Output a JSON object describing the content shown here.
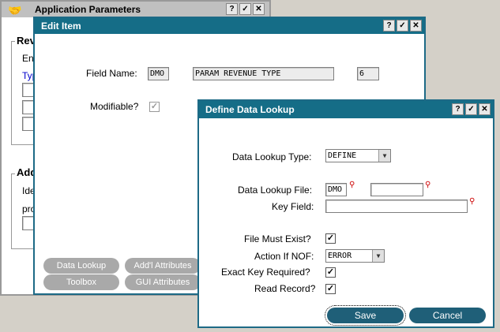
{
  "app_window": {
    "title": "Application Parameters",
    "title_buttons": [
      "?",
      "✓",
      "✕"
    ],
    "group1_title": "Rev",
    "group1_text1": "En",
    "group1_link": "Typ",
    "group2_title": "Add",
    "group2_text1": "Ide",
    "group2_text2": "pro"
  },
  "edit_item": {
    "title": "Edit Item",
    "title_buttons": [
      "?",
      "✓",
      "✕"
    ],
    "field_name_label": "Field Name:",
    "field_prefix": "DMO",
    "field_name": "PARAM REVENUE TYPE",
    "field_number": "6",
    "modifiable_label": "Modifiable?",
    "modifiable_check": "✓",
    "buttons": {
      "data_lookup": "Data Lookup",
      "addl_attributes": "Add'l Attributes",
      "toolbox": "Toolbox",
      "gui_attributes": "GUI Attributes"
    }
  },
  "lookup": {
    "title": "Define Data Lookup",
    "title_buttons": [
      "?",
      "✓",
      "✕"
    ],
    "type_label": "Data Lookup Type:",
    "type_value": "DEFINE",
    "file_label": "Data Lookup File:",
    "file_prefix": "DMO",
    "file_value": "",
    "key_label": "Key Field:",
    "key_value": "",
    "must_exist_label": "File Must Exist?",
    "action_label": "Action If NOF:",
    "action_value": "ERROR",
    "exact_key_label": "Exact Key Required?",
    "read_record_label": "Read Record?",
    "check_mark": "✓",
    "search_glyph": "⚲",
    "dropdown_glyph": "▼",
    "save": "Save",
    "cancel": "Cancel"
  },
  "colors": {
    "titlebar": "#156d87",
    "button": "#1f5f78",
    "disabled_button": "#a9a9a9"
  }
}
